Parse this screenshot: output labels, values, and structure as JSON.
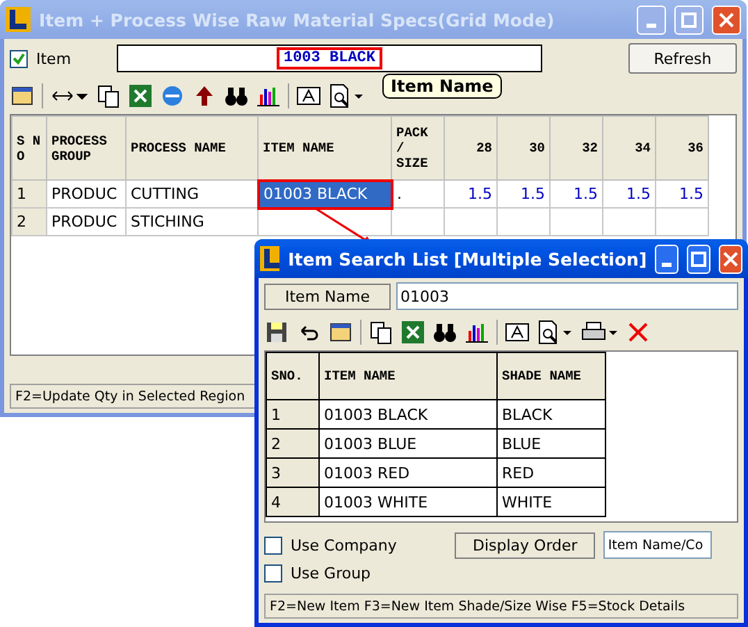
{
  "main_window": {
    "title": "Item + Process Wise Raw Material Specs(Grid Mode)",
    "item_filter": {
      "label": "Item",
      "checked": true,
      "value": "1003 BLACK"
    },
    "refresh_button": "Refresh",
    "tooltip": "Item Name",
    "grid": {
      "columns": [
        "S N O",
        "PROCESS GROUP",
        "PROCESS NAME",
        "ITEM NAME",
        "PACK / SIZE",
        "28",
        "30",
        "32",
        "34",
        "36"
      ],
      "rows": [
        {
          "sno": "1",
          "process_group": "PRODUC",
          "process_name": "CUTTING",
          "item_name": "01003 BLACK",
          "pack_size": ".",
          "sizes": [
            "1.5",
            "1.5",
            "1.5",
            "1.5",
            "1.5"
          ],
          "selected": true
        },
        {
          "sno": "2",
          "process_group": "PRODUC",
          "process_name": "STICHING",
          "selected": false
        }
      ]
    },
    "status_bar": "F2=Update Qty in Selected Region"
  },
  "search_window": {
    "title": "Item Search List [Multiple Selection]",
    "search": {
      "label": "Item Name",
      "value": "01003"
    },
    "grid": {
      "columns": [
        "SNO.",
        "ITEM NAME",
        "SHADE NAME"
      ],
      "rows": [
        {
          "sno": "1",
          "item_name": "01003 BLACK",
          "shade_name": "BLACK"
        },
        {
          "sno": "2",
          "item_name": "01003 BLUE",
          "shade_name": "BLUE"
        },
        {
          "sno": "3",
          "item_name": "01003 RED",
          "shade_name": "RED"
        },
        {
          "sno": "4",
          "item_name": "01003 WHITE",
          "shade_name": "WHITE"
        }
      ]
    },
    "options": [
      {
        "label": "Use Company",
        "checked": false
      },
      {
        "label": "Use Group",
        "checked": false
      }
    ],
    "display_order": {
      "label": "Display Order",
      "value": "Item Name/Co"
    },
    "status_bar": "F2=New Item  F3=New Item Shade/Size Wise  F5=Stock Details"
  }
}
